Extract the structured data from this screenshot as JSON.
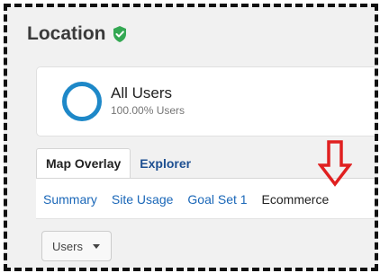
{
  "header": {
    "title": "Location"
  },
  "segment": {
    "name": "All Users",
    "subtitle": "100.00% Users"
  },
  "tabs": [
    {
      "label": "Map Overlay",
      "active": true
    },
    {
      "label": "Explorer",
      "active": false
    }
  ],
  "subnav": [
    {
      "label": "Summary"
    },
    {
      "label": "Site Usage"
    },
    {
      "label": "Goal Set 1"
    },
    {
      "label": "Ecommerce"
    }
  ],
  "dimension_button": {
    "label": "Users"
  },
  "colors": {
    "verified_shield": "#34a853",
    "ring": "#1e88c8",
    "link": "#1a67b8",
    "arrow": "#e02020"
  },
  "icons": {
    "verified": "shield-check-icon",
    "segment": "ring-icon",
    "pointer": "down-arrow-icon",
    "dropdown": "caret-down-icon"
  }
}
